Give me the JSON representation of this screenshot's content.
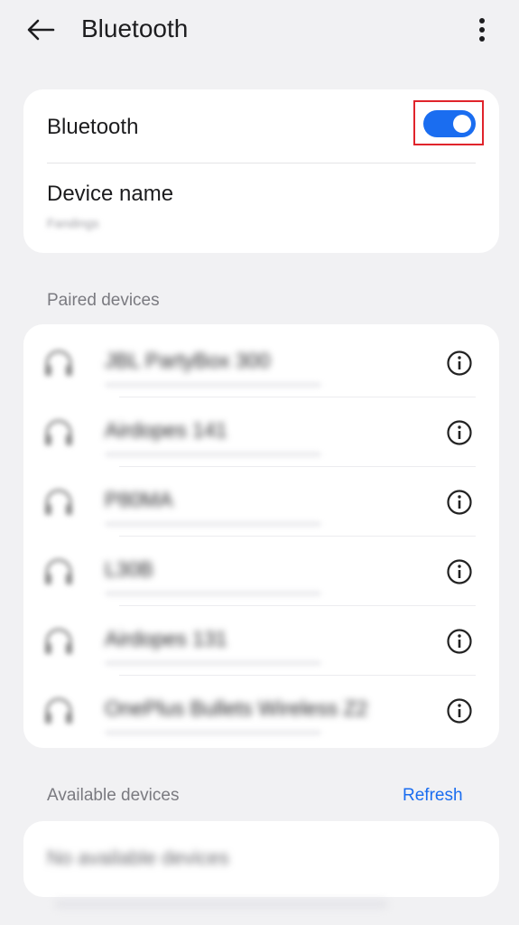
{
  "header": {
    "title": "Bluetooth"
  },
  "bluetooth": {
    "label": "Bluetooth",
    "enabled": true,
    "accent": "#1a6df0",
    "highlight_color": "#e0242b"
  },
  "device_name": {
    "label": "Device name",
    "value": "Fandings"
  },
  "paired": {
    "section_label": "Paired devices",
    "devices": [
      {
        "name": "JBL PartyBox 300",
        "icon": "headset-icon"
      },
      {
        "name": "Airdopes 141",
        "icon": "headset-icon"
      },
      {
        "name": "P80MA",
        "icon": "headset-icon"
      },
      {
        "name": "L30B",
        "icon": "headset-icon"
      },
      {
        "name": "Airdopes 131",
        "icon": "headset-icon"
      },
      {
        "name": "OnePlus Bullets Wireless Z2",
        "icon": "headset-icon"
      }
    ]
  },
  "available": {
    "section_label": "Available devices",
    "refresh_label": "Refresh",
    "empty_text": "No available devices"
  }
}
